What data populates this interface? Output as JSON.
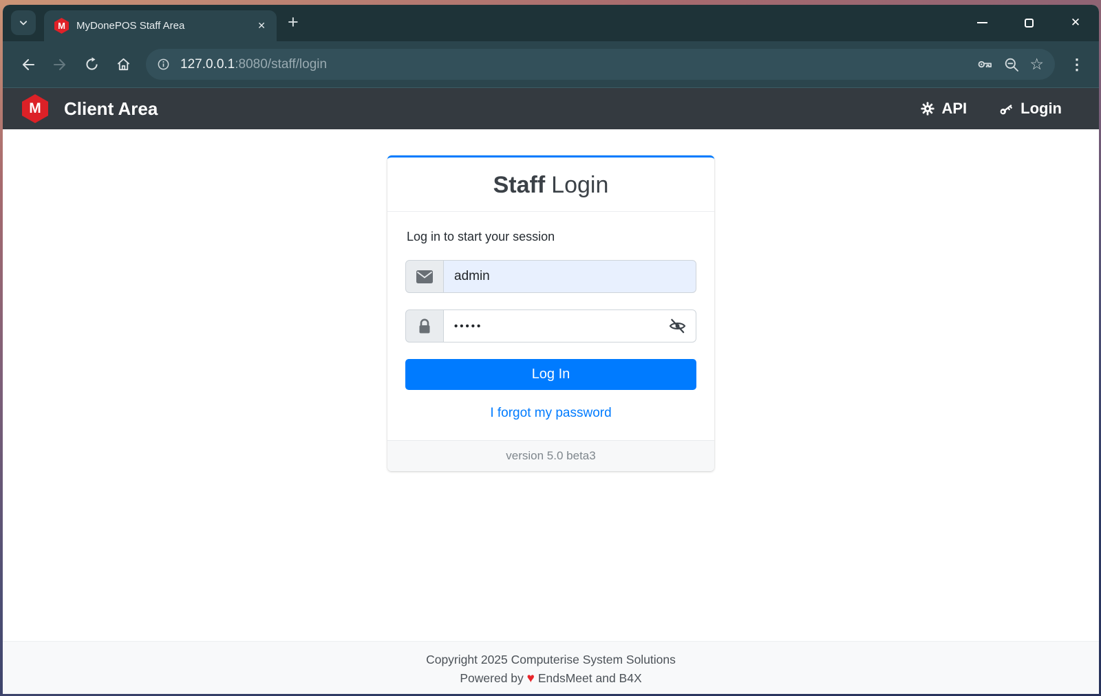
{
  "browser": {
    "tab_title": "MyDonePOS Staff Area",
    "favicon_letter": "M",
    "url_host": "127.0.0.1",
    "url_path": ":8080/staff/login"
  },
  "navbar": {
    "logo_letter": "M",
    "brand": "Client Area",
    "api_label": "API",
    "login_label": "Login"
  },
  "login": {
    "title_bold": "Staff",
    "title_light": "Login",
    "message": "Log in to start your session",
    "username_value": "admin",
    "password_value": "•••••",
    "login_button_label": "Log In",
    "forgot_password_label": "I forgot my password",
    "version_label": "version 5.0 beta3"
  },
  "page_footer": {
    "copyright": "Copyright 2025 Computerise System Solutions",
    "powered_by_prefix": "Powered by",
    "powered_by_suffix": "EndsMeet and B4X"
  },
  "icons": {
    "close": "✕",
    "plus": "+",
    "menu_dots": "⋮",
    "star": "☆",
    "heart": "♥"
  },
  "colors": {
    "accent_blue": "#007bff",
    "brand_red": "#dc2127",
    "heart_red": "#e8252a",
    "autofill_blue": "#e8f0fe",
    "navbar_dark": "#343a40"
  }
}
